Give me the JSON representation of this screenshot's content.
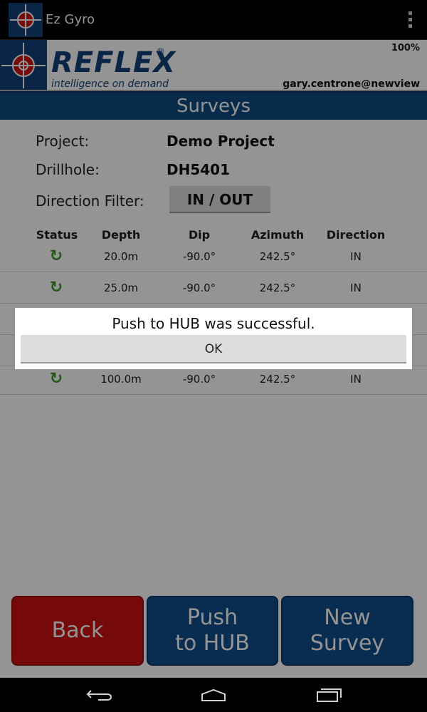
{
  "app": {
    "title": "Ez Gyro"
  },
  "header": {
    "logo_word": "REFLEX",
    "logo_reg": "®",
    "tagline": "intelligence on demand",
    "battery": "100%",
    "user": "gary.centrone@newview"
  },
  "page": {
    "title": "Surveys"
  },
  "info": {
    "project_label": "Project:",
    "project_value": "Demo Project",
    "drillhole_label": "Drillhole:",
    "drillhole_value": "DH5401",
    "filter_label": "Direction Filter:",
    "filter_value": "IN / OUT"
  },
  "table": {
    "headers": [
      "Status",
      "Depth",
      "Dip",
      "Azimuth",
      "Direction"
    ],
    "rows": [
      {
        "depth": "20.0m",
        "dip": "-90.0°",
        "azimuth": "242.5°",
        "direction": "IN"
      },
      {
        "depth": "25.0m",
        "dip": "-90.0°",
        "azimuth": "242.5°",
        "direction": "IN"
      },
      {
        "depth": "100.0m",
        "dip": "-90.0°",
        "azimuth": "242.5°",
        "direction": "IN"
      }
    ]
  },
  "buttons": {
    "back": "Back",
    "push_line1": "Push",
    "push_line2": "to HUB",
    "new_line1": "New",
    "new_line2": "Survey"
  },
  "dialog": {
    "message": "Push to HUB was successful.",
    "ok": "OK"
  },
  "colors": {
    "brand_blue": "#14417a",
    "title_bar": "#0e4a83",
    "back_red": "#cc1111",
    "sync_green": "#3f9a2c"
  },
  "icons": {
    "app": "crosshair-logo-icon",
    "status": "sync-icon",
    "nav": [
      "nav-back-icon",
      "nav-home-icon",
      "nav-recents-icon"
    ]
  }
}
